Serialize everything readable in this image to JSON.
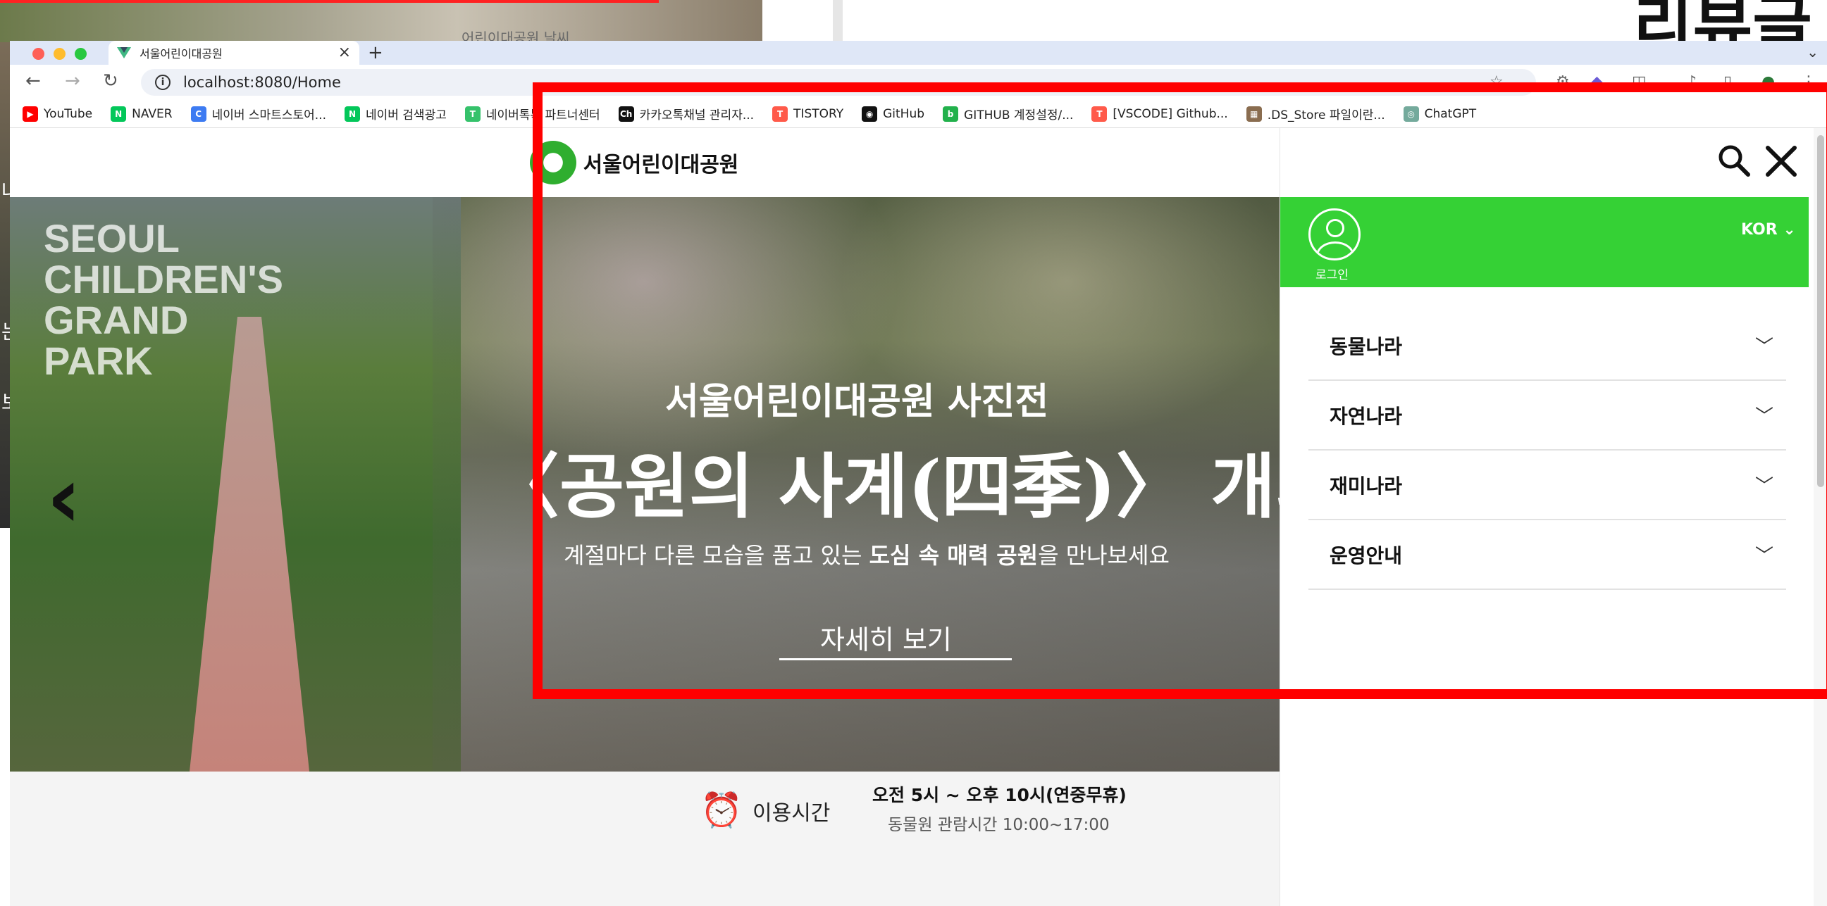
{
  "background": {
    "tab_text": "어린이대공원 날씨",
    "left_strip_chars": [
      "나",
      "",
      "는",
      "보"
    ]
  },
  "browser": {
    "tab_title": "서울어린이대공원",
    "tab_close": "×",
    "new_tab": "+",
    "tab_menu": "⌄",
    "url": "localhost:8080/Home",
    "bookmarks": [
      {
        "label": "YouTube",
        "color": "#ff0000",
        "icon": "▶"
      },
      {
        "label": "NAVER",
        "color": "#03c75a",
        "icon": "N"
      },
      {
        "label": "네이버 스마트스토어...",
        "color": "#3d7bf2",
        "icon": "C"
      },
      {
        "label": "네이버 검색광고",
        "color": "#03c75a",
        "icon": "N"
      },
      {
        "label": "네이버톡톡 파트너센터",
        "color": "#35c26b",
        "icon": "T"
      },
      {
        "label": "카카오톡채널 관리자...",
        "color": "#111111",
        "icon": "Ch"
      },
      {
        "label": "TISTORY",
        "color": "#ff5a4a",
        "icon": "T"
      },
      {
        "label": "GitHub",
        "color": "#111111",
        "icon": "◉"
      },
      {
        "label": "GITHUB 계정설정/...",
        "color": "#22b14c",
        "icon": "b"
      },
      {
        "label": "[VSCODE] Github...",
        "color": "#ff5a4a",
        "icon": "T"
      },
      {
        "label": ".DS_Store 파일이란...",
        "color": "#8a6d50",
        "icon": "▦"
      },
      {
        "label": "ChatGPT",
        "color": "#74aa9c",
        "icon": "◎"
      }
    ]
  },
  "site": {
    "logo_text": "서울어린이대공원",
    "hero": {
      "left_title": [
        "SEOUL",
        "CHILDREN'S",
        "GRAND",
        "PARK"
      ],
      "prev": "‹",
      "subtitle": "서울어린이대공원 사진전",
      "title": "〈공원의 사계(四季)〉 개최",
      "desc_pre": "계절마다 다른 모습을 품고 있는 ",
      "desc_bold": "도심 속 매력 공원",
      "desc_post": "을 만나보세요",
      "more": "자세히 보기"
    },
    "info": {
      "clock_icon": "⏰",
      "hours_label": "이용시간",
      "hours_value": "오전 5시 ~ 오후 10시(연중무휴)",
      "zoo_hours": "동물원 관람시간 10:00~17:00"
    }
  },
  "side_menu": {
    "login": "로그인",
    "language": "KOR ⌄",
    "items": [
      {
        "label": "동물나라"
      },
      {
        "label": "자연나라"
      },
      {
        "label": "재미나라"
      },
      {
        "label": "운영안내"
      }
    ],
    "chevron": "⌄",
    "accent": "#35d135"
  },
  "highlight_color": "#ff0000"
}
